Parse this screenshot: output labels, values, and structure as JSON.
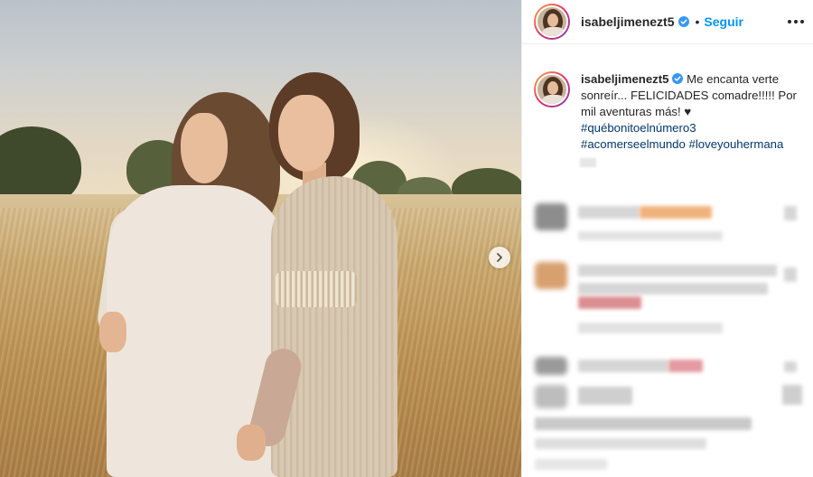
{
  "post": {
    "username": "isabeljimenezt5",
    "follow_label": "Seguir",
    "separator": "•",
    "caption": {
      "username": "isabeljimenezt5",
      "text": " Me encanta verte sonreír... FELICIDADES comadre!!!!! Por mil aventuras más! ♥",
      "hashtags": [
        "#québonitoelnúmero3",
        "#acomerseelmundo",
        "#loveyouhermana"
      ]
    }
  },
  "colors": {
    "follow_blue": "#0095f6",
    "verified_blue": "#3897f0",
    "hashtag": "#00376b",
    "text": "#262626"
  },
  "icons": {
    "verified": "verified-badge-icon",
    "more": "more-options-icon",
    "next": "chevron-right-icon"
  }
}
